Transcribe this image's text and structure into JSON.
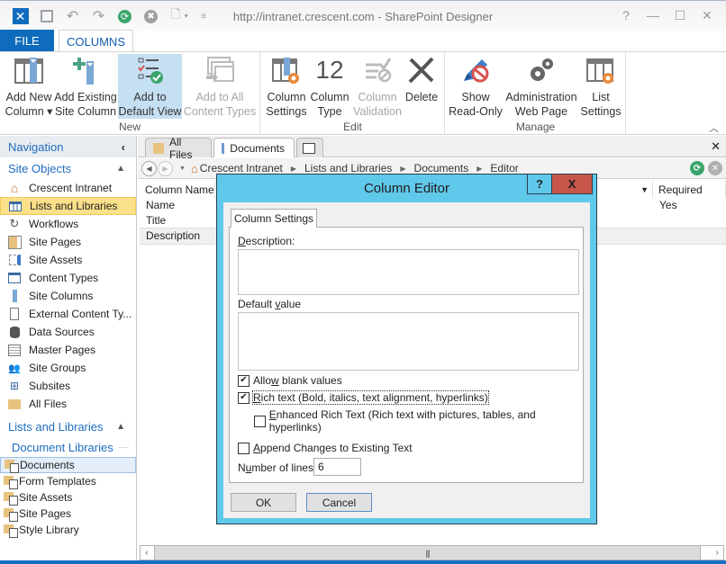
{
  "window": {
    "title": "http://intranet.crescent.com - SharePoint Designer",
    "controls": {
      "help": "?",
      "minimize": "—",
      "maximize": "☐",
      "close": "✕"
    }
  },
  "quick_access": [
    {
      "name": "save-icon",
      "glyph": "🖫"
    },
    {
      "name": "undo-icon",
      "glyph": "↶"
    },
    {
      "name": "redo-icon",
      "glyph": "↷"
    },
    {
      "name": "refresh-icon",
      "glyph": "⟳"
    },
    {
      "name": "stop-icon",
      "glyph": "✖"
    },
    {
      "name": "preview-icon",
      "glyph": "🔍"
    }
  ],
  "ribbon": {
    "tabs": {
      "file": "FILE",
      "columns": "COLUMNS"
    },
    "groups": {
      "new": {
        "label": "New",
        "buttons": [
          {
            "line1": "Add New",
            "line2": "Column ▾",
            "state": "normal"
          },
          {
            "line1": "Add Existing",
            "line2": "Site Column",
            "state": "normal"
          },
          {
            "line1": "Add to",
            "line2": "Default View",
            "state": "active"
          },
          {
            "line1": "Add to All",
            "line2": "Content Types",
            "state": "disabled"
          }
        ]
      },
      "edit": {
        "label": "Edit",
        "buttons": [
          {
            "line1": "Column",
            "line2": "Settings",
            "state": "normal"
          },
          {
            "line1": "Column",
            "line2": "Type",
            "state": "normal",
            "icon_text": "12"
          },
          {
            "line1": "Column",
            "line2": "Validation",
            "state": "disabled"
          },
          {
            "line1": "Delete",
            "line2": "",
            "state": "normal"
          }
        ]
      },
      "manage": {
        "label": "Manage",
        "buttons": [
          {
            "line1": "Show",
            "line2": "Read-Only",
            "state": "normal"
          },
          {
            "line1": "Administration",
            "line2": "Web Page",
            "state": "normal"
          },
          {
            "line1": "List",
            "line2": "Settings",
            "state": "normal"
          }
        ]
      }
    }
  },
  "navigation": {
    "header": "Navigation",
    "site_objects": {
      "label": "Site Objects",
      "items": [
        {
          "label": "Crescent Intranet",
          "icon": "home-icon",
          "selected": false
        },
        {
          "label": "Lists and Libraries",
          "icon": "list-icon",
          "selected": true
        },
        {
          "label": "Workflows",
          "icon": "workflow-icon",
          "selected": false
        },
        {
          "label": "Site Pages",
          "icon": "pages-icon",
          "selected": false
        },
        {
          "label": "Site Assets",
          "icon": "assets-icon",
          "selected": false
        },
        {
          "label": "Content Types",
          "icon": "content-type-icon",
          "selected": false
        },
        {
          "label": "Site Columns",
          "icon": "column-icon",
          "selected": false
        },
        {
          "label": "External Content Ty...",
          "icon": "external-content-icon",
          "selected": false
        },
        {
          "label": "Data Sources",
          "icon": "database-icon",
          "selected": false
        },
        {
          "label": "Master Pages",
          "icon": "master-page-icon",
          "selected": false
        },
        {
          "label": "Site Groups",
          "icon": "group-icon",
          "selected": false
        },
        {
          "label": "Subsites",
          "icon": "sitemap-icon",
          "selected": false
        },
        {
          "label": "All Files",
          "icon": "folder-icon",
          "selected": false
        }
      ]
    },
    "lists_libraries": {
      "label": "Lists and Libraries",
      "subheader": "Document Libraries",
      "items": [
        {
          "label": "Documents",
          "selected": true
        },
        {
          "label": "Form Templates",
          "selected": false
        },
        {
          "label": "Site Assets",
          "selected": false
        },
        {
          "label": "Site Pages",
          "selected": false
        },
        {
          "label": "Style Library",
          "selected": false
        }
      ]
    }
  },
  "doc_tabs": [
    {
      "label": "All Files",
      "active": false
    },
    {
      "label": "Documents",
      "active": true
    }
  ],
  "breadcrumb": [
    "Crescent Intranet",
    "Lists and Libraries",
    "Documents",
    "Editor"
  ],
  "grid": {
    "columns": [
      "Column Name",
      "Required"
    ],
    "rows": [
      {
        "name": "Name",
        "required": "Yes"
      },
      {
        "name": "Title",
        "required": ""
      },
      {
        "name": "Description",
        "required": ""
      }
    ]
  },
  "dialog": {
    "title": "Column Editor",
    "help": "?",
    "close": "X",
    "tab": "Column Settings",
    "description_label_pre": "",
    "description_label_ul": "D",
    "description_label_post": "escription:",
    "description_value": "",
    "default_label_pre": "Default ",
    "default_label_ul": "v",
    "default_label_post": "alue",
    "default_value": "",
    "allow_blank": {
      "pre": "Allo",
      "ul": "w",
      "post": " blank values",
      "checked": true
    },
    "rich_text": {
      "pre": "",
      "ul": "R",
      "post": "ich text (Bold, italics, text alignment, hyperlinks)",
      "checked": true
    },
    "enhanced_rich": {
      "pre": "",
      "ul": "E",
      "post": "nhanced Rich Text (Rich text with pictures, tables, and hyperlinks)",
      "checked": false
    },
    "append_changes": {
      "pre": "",
      "ul": "A",
      "post": "ppend Changes to Existing Text",
      "checked": false
    },
    "lines_label_pre": "N",
    "lines_label_ul": "u",
    "lines_label_post": "mber of lines:",
    "lines_value": "6",
    "ok": "OK",
    "cancel": "Cancel"
  }
}
